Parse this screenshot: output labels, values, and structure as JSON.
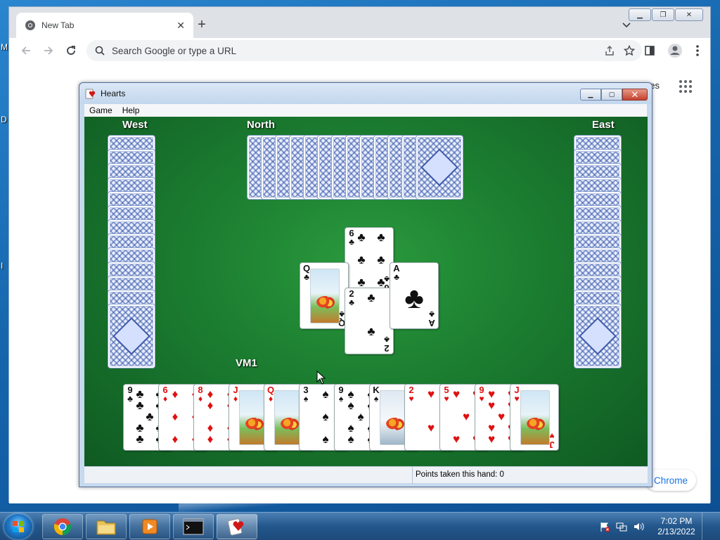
{
  "desktop": {
    "edge_letters": [
      "M",
      "D",
      "I"
    ]
  },
  "chrome": {
    "tab_title": "New Tab",
    "tab_close": "✕",
    "new_tab": "+",
    "omnibox_placeholder": "Search Google or type a URL",
    "images_link": "es",
    "customize_chip": "Chrome"
  },
  "hearts": {
    "title": "Hearts",
    "menu": [
      "Game",
      "Help"
    ],
    "players": {
      "west": "West",
      "north": "North",
      "east": "East",
      "south": "VM1"
    },
    "status": "Points taken this hand: 0",
    "west_back_count": 13,
    "north_back_count": 13,
    "east_back_count": 13,
    "trick": [
      {
        "who": "north",
        "rank": "6",
        "suit": "♣",
        "color": "black"
      },
      {
        "who": "west",
        "rank": "Q",
        "suit": "♣",
        "color": "black",
        "face": true
      },
      {
        "who": "south",
        "rank": "2",
        "suit": "♣",
        "color": "black"
      },
      {
        "who": "east",
        "rank": "A",
        "suit": "♣",
        "color": "black"
      }
    ],
    "hand": [
      {
        "rank": "9",
        "suit": "♣",
        "color": "black"
      },
      {
        "rank": "6",
        "suit": "♦",
        "color": "red"
      },
      {
        "rank": "8",
        "suit": "♦",
        "color": "red"
      },
      {
        "rank": "J",
        "suit": "♦",
        "color": "red",
        "face": true
      },
      {
        "rank": "Q",
        "suit": "♦",
        "color": "red",
        "face": true
      },
      {
        "rank": "3",
        "suit": "♠",
        "color": "black"
      },
      {
        "rank": "9",
        "suit": "♠",
        "color": "black"
      },
      {
        "rank": "K",
        "suit": "♠",
        "color": "black",
        "face": true
      },
      {
        "rank": "2",
        "suit": "♥",
        "color": "red"
      },
      {
        "rank": "5",
        "suit": "♥",
        "color": "red"
      },
      {
        "rank": "9",
        "suit": "♥",
        "color": "red"
      },
      {
        "rank": "J",
        "suit": "♥",
        "color": "red",
        "face": true
      }
    ]
  },
  "taskbar": {
    "time": "7:02 PM",
    "date": "2/13/2022",
    "apps": [
      "start-button",
      "chrome",
      "explorer",
      "media-player",
      "cmd",
      "hearts"
    ]
  },
  "colors": {
    "felt": "#1c7f31",
    "taskbar": "#23578c",
    "red_suit": "#e01010"
  }
}
